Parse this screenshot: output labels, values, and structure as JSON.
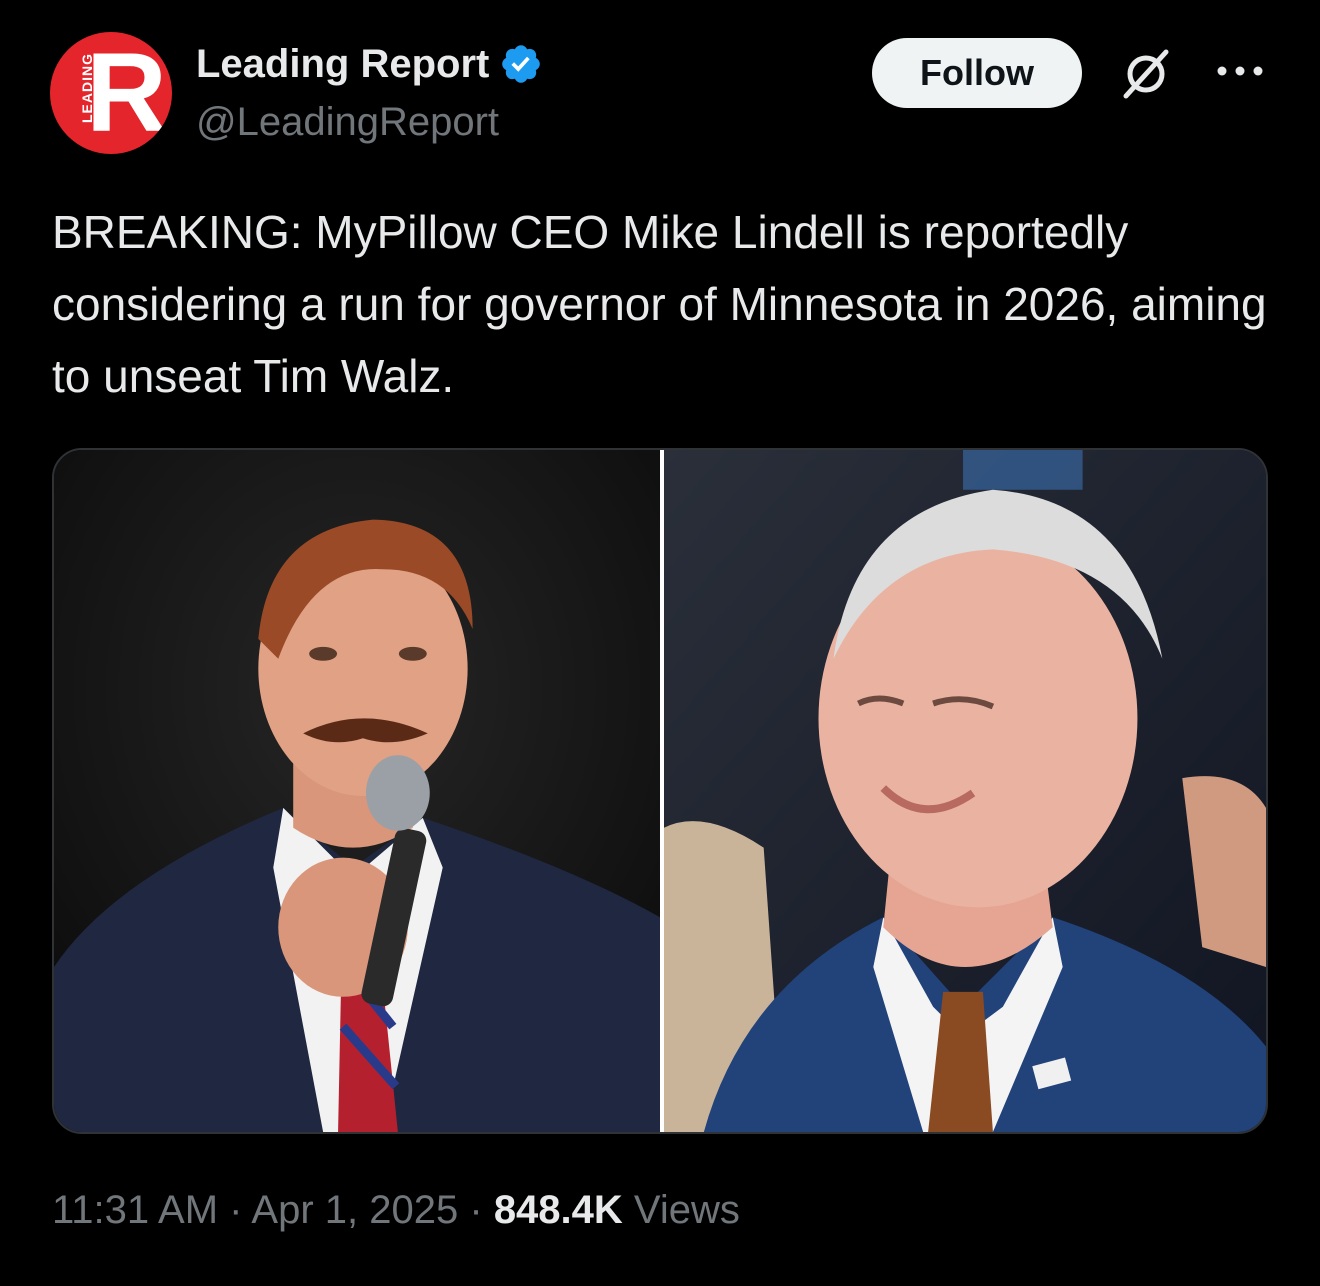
{
  "author": {
    "display_name": "Leading Report",
    "handle": "@LeadingReport",
    "avatar_letter": "R",
    "avatar_side_text": "LEADING",
    "verified_color": "#1d9bf0",
    "brand_color": "#e4252b"
  },
  "actions": {
    "follow_label": "Follow"
  },
  "icons": {
    "verified": "verified-badge-icon",
    "grok": "grok-icon",
    "more": "more-dots-icon"
  },
  "tweet": {
    "text": "BREAKING: MyPillow CEO Mike Lindell is reportedly considering a run for governor of Minnesota in 2026, aiming to unseat Tim Walz."
  },
  "media": {
    "photos": [
      "photo-mike-lindell",
      "photo-tim-walz"
    ]
  },
  "meta": {
    "time": "11:31 AM",
    "separator": "·",
    "date": "Apr 1, 2025",
    "views_count": "848.4K",
    "views_label": "Views"
  }
}
